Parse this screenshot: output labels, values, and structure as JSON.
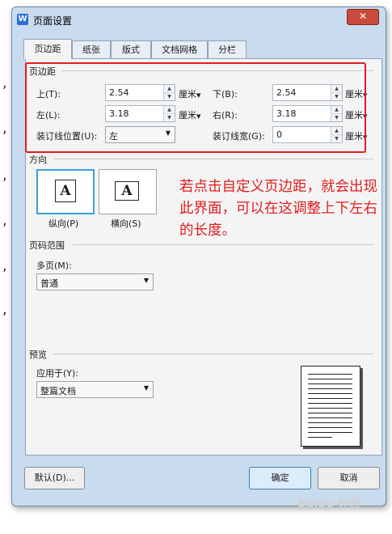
{
  "dialog": {
    "title": "页面设置",
    "app_icon_letter": "W",
    "close_glyph": "✕"
  },
  "tabs": [
    "页边距",
    "纸张",
    "版式",
    "文档网格",
    "分栏"
  ],
  "margins": {
    "group_title": "页边距",
    "top_label": "上(T):",
    "top_value": "2.54",
    "bottom_label": "下(B):",
    "bottom_value": "2.54",
    "left_label": "左(L):",
    "left_value": "3.18",
    "right_label": "右(R):",
    "right_value": "3.18",
    "gutter_pos_label": "装订线位置(U):",
    "gutter_pos_value": "左",
    "gutter_width_label": "装订线宽(G):",
    "gutter_width_value": "0",
    "unit": "厘米"
  },
  "orientation": {
    "group_title": "方向",
    "portrait_label": "纵向(P)",
    "landscape_label": "横向(S)",
    "icon_letter": "A"
  },
  "page_range": {
    "group_title": "页码范围",
    "multi_label": "多页(M):",
    "multi_value": "普通"
  },
  "preview": {
    "group_title": "预览",
    "apply_label": "应用于(Y):",
    "apply_value": "整篇文档"
  },
  "buttons": {
    "default": "默认(D)...",
    "ok": "确定",
    "cancel": "取消"
  },
  "annotation": {
    "text": "若点击自定义页边距，就会出现此界面，可以在这调整上下左右的长度。",
    "color": "#e11c1c"
  },
  "background_marks": [
    ",",
    ",",
    ",",
    ",",
    ",",
    ","
  ],
  "watermark": "Baidu 经验"
}
